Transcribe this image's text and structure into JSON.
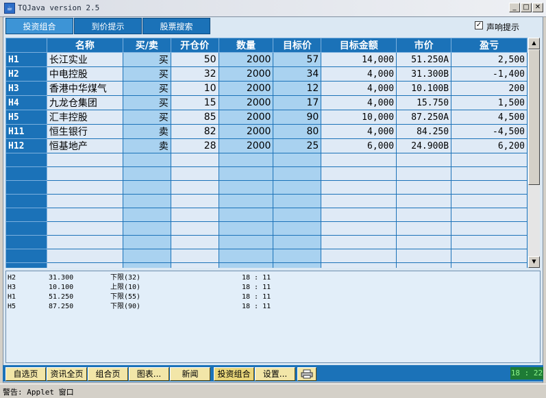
{
  "window": {
    "title": "TQJava version 2.5"
  },
  "tabs": [
    {
      "label": "投资组合",
      "active": true
    },
    {
      "label": "到价提示",
      "active": false
    },
    {
      "label": "股票搜索",
      "active": false
    }
  ],
  "sound_alert": {
    "label": "声响提示",
    "checked": true
  },
  "table": {
    "columns": [
      "",
      "名称",
      "买/卖",
      "开仓价",
      "数量",
      "目标价",
      "目标金额",
      "市价",
      "盈亏"
    ],
    "rows": [
      {
        "id": "H1",
        "name": "长江实业",
        "side": "买",
        "open": "50",
        "qty": "2000",
        "target": "57",
        "target_amount": "14,000",
        "market": "51.250A",
        "pnl": "2,500"
      },
      {
        "id": "H2",
        "name": "中电控股",
        "side": "买",
        "open": "32",
        "qty": "2000",
        "target": "34",
        "target_amount": "4,000",
        "market": "31.300B",
        "pnl": "-1,400"
      },
      {
        "id": "H3",
        "name": "香港中华煤气",
        "side": "买",
        "open": "10",
        "qty": "2000",
        "target": "12",
        "target_amount": "4,000",
        "market": "10.100B",
        "pnl": "200"
      },
      {
        "id": "H4",
        "name": "九龙仓集团",
        "side": "买",
        "open": "15",
        "qty": "2000",
        "target": "17",
        "target_amount": "4,000",
        "market": "15.750",
        "pnl": "1,500"
      },
      {
        "id": "H5",
        "name": "汇丰控股",
        "side": "买",
        "open": "85",
        "qty": "2000",
        "target": "90",
        "target_amount": "10,000",
        "market": "87.250A",
        "pnl": "4,500"
      },
      {
        "id": "H11",
        "name": "恒生银行",
        "side": "卖",
        "open": "82",
        "qty": "2000",
        "target": "80",
        "target_amount": "4,000",
        "market": "84.250",
        "pnl": "-4,500"
      },
      {
        "id": "H12",
        "name": "恒基地产",
        "side": "卖",
        "open": "28",
        "qty": "2000",
        "target": "25",
        "target_amount": "6,000",
        "market": "24.900B",
        "pnl": "6,200"
      }
    ]
  },
  "alerts": [
    {
      "id": "H2",
      "price": "31.300",
      "limit": "下限(32)",
      "time": "18 : 11"
    },
    {
      "id": "H3",
      "price": "10.100",
      "limit": "上限(10)",
      "time": "18 : 11"
    },
    {
      "id": "H1",
      "price": "51.250",
      "limit": "下限(55)",
      "time": "18 : 11"
    },
    {
      "id": "H5",
      "price": "87.250",
      "limit": "下限(90)",
      "time": "18 : 11"
    }
  ],
  "bottom_buttons": [
    {
      "label": "自选页",
      "active": false
    },
    {
      "label": "资讯全页",
      "active": false
    },
    {
      "label": "组合页",
      "active": false
    },
    {
      "label": "图表...",
      "active": false
    },
    {
      "label": "新闻",
      "active": false
    },
    {
      "label": "投资组合",
      "active": true
    },
    {
      "label": "设置...",
      "active": false
    }
  ],
  "clock": "18 : 22",
  "status": "警告: Applet 窗口",
  "icons": {
    "app": "java-app-icon",
    "print": "printer-icon"
  },
  "colors": {
    "header": "#1b72b8",
    "bottom_button": "#f2e6a8",
    "clock_bg": "#1e7b35"
  }
}
